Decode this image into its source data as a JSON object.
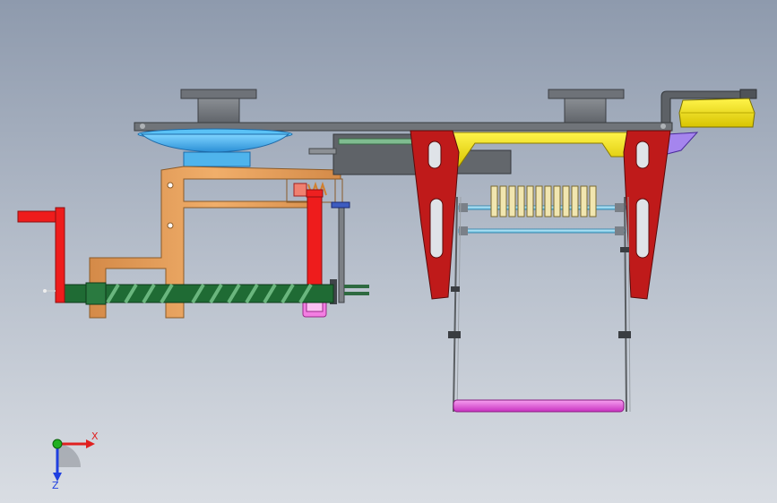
{
  "app": {
    "view": "cad-model-viewport"
  },
  "triad": {
    "x_label": "X",
    "z_label": "Z",
    "colors": {
      "x": "#e02020",
      "y": "#20b020",
      "z": "#2040e0"
    }
  },
  "palette": {
    "frame_gray": "#6f7378",
    "blue_disk": "#3ab0f0",
    "bracket_orange": "#e8a05a",
    "crank_red": "#ee1c1c",
    "screw_green": "#1f6b34",
    "arm_dark_red": "#c01818",
    "yellow_channel": "#f2df60",
    "handle_yellow": "#ffee00",
    "spring_cream": "#f0e8b8",
    "rod_cyan": "#8fd6ee",
    "bar_magenta": "#e050d8",
    "lilac": "#a080e8",
    "coupling_pink": "#f080e0"
  }
}
